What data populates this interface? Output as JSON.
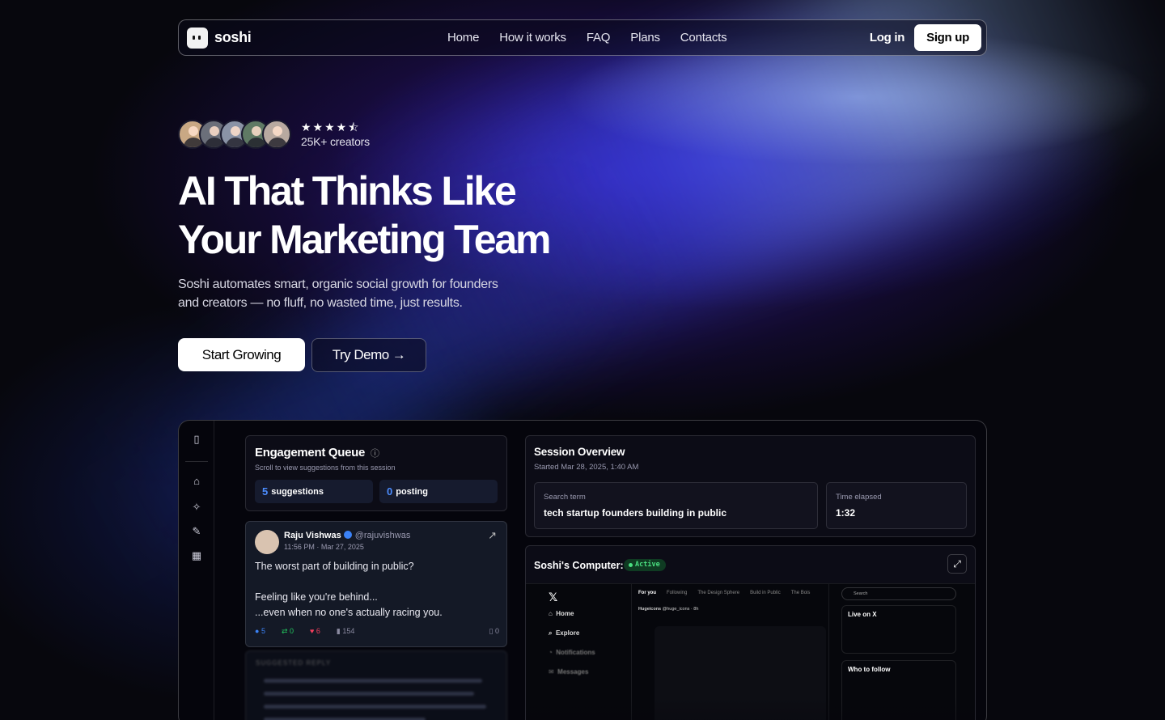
{
  "nav": {
    "brand": "soshi",
    "links": [
      "Home",
      "How it works",
      "FAQ",
      "Plans",
      "Contacts"
    ],
    "login": "Log in",
    "signup": "Sign up"
  },
  "hero": {
    "rating_stars": 4.5,
    "creators": "25K+ creators",
    "headline_line1": "AI That Thinks Like",
    "headline_line2": "Your Marketing Team",
    "subtitle_line1": "Soshi automates smart, organic social growth for founders",
    "subtitle_line2": "and creators — no fluff, no wasted time, just results.",
    "cta_primary": "Start Growing",
    "cta_secondary": "Try Demo",
    "cta_secondary_icon": "arrow-right-icon"
  },
  "dashboard": {
    "sidebar_icons": [
      "panel-toggle-icon",
      "home-icon",
      "sparkle-cursor-icon",
      "pen-icon",
      "calendar-icon"
    ],
    "engagement_queue": {
      "title": "Engagement Queue",
      "subtitle": "Scroll to view suggestions from this session",
      "suggestions_count": "5",
      "suggestions_label": "suggestions",
      "posting_count": "0",
      "posting_label": "posting"
    },
    "tweet": {
      "author": "Raju Vishwas",
      "handle": "@rajuvishwas",
      "time": "11:56 PM · Mar 27, 2025",
      "line1": "The worst part of building in public?",
      "line2": "Feeling like you're behind...",
      "line3": "...even when no one's actually racing you.",
      "replies": "5",
      "retweets": "0",
      "likes": "6",
      "views": "154",
      "bookmarks": "0"
    },
    "suggested_reply": {
      "label": "SUGGESTED REPLY"
    },
    "session": {
      "title": "Session Overview",
      "started": "Started Mar 28, 2025, 1:40 AM",
      "search_label": "Search term",
      "search_value": "tech startup founders building in public",
      "elapsed_label": "Time elapsed",
      "elapsed_value": "1:32"
    },
    "computer": {
      "title": "Soshi's Computer:",
      "status": "Active",
      "x_nav": [
        "Home",
        "Explore",
        "Notifications",
        "Messages"
      ],
      "x_tabs": [
        "For you",
        "Following",
        "The Design Sphere",
        "Build in Public",
        "The Bois"
      ],
      "x_post_author": "Hugeicons",
      "x_post_handle": "@huge_icons · 8h",
      "x_search": "Search",
      "x_live": "Live on X",
      "x_follow": "Who to follow"
    }
  },
  "colors": {
    "accent_blue": "#4c8dff",
    "active_green": "#4ade80",
    "like_red": "#f43f5e"
  }
}
